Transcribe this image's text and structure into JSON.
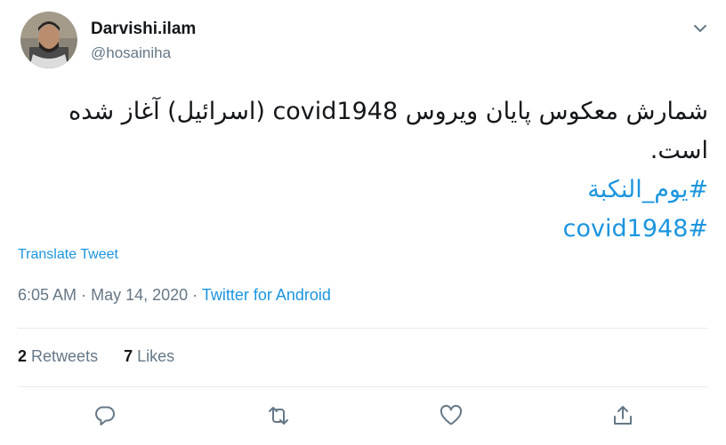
{
  "author": {
    "name": "Darvishi.ilam",
    "handle": "@hosainiha"
  },
  "tweet": {
    "line1": "شمارش معکوس پایان ویروس covid1948 (اسرائیل) آغاز شده",
    "line2": "است.",
    "hashtag1": "#یوم_النکبة",
    "hashtag2": "#covid1948"
  },
  "translate_label": "Translate Tweet",
  "meta": {
    "time": "6:05 AM",
    "separator": "·",
    "date": "May 14, 2020",
    "source": "Twitter for Android"
  },
  "stats": {
    "retweets_count": "2",
    "retweets_label": "Retweets",
    "likes_count": "7",
    "likes_label": "Likes"
  },
  "actions": {
    "reply_icon": "reply-icon",
    "retweet_icon": "retweet-icon",
    "like_icon": "heart-icon",
    "share_icon": "share-icon"
  },
  "colors": {
    "link": "#1b95e0",
    "secondary_text": "#657786",
    "primary_text": "#14171a",
    "divider": "#e6ecf0"
  }
}
